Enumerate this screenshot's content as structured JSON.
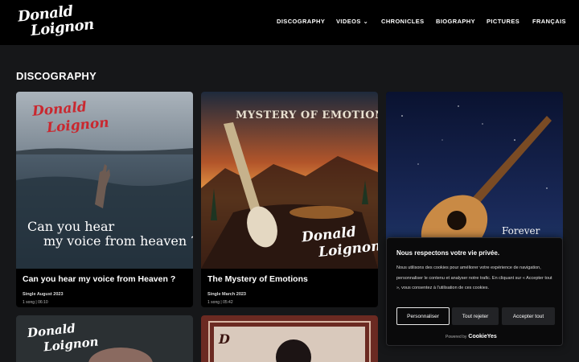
{
  "header": {
    "logo_line1": "Donald",
    "logo_line2": "Loignon",
    "nav": [
      {
        "label": "DISCOGRAPHY"
      },
      {
        "label": "VIDEOS",
        "chevron": "⌄"
      },
      {
        "label": "CHRONICLES"
      },
      {
        "label": "BIOGRAPHY"
      },
      {
        "label": "PICTURES"
      },
      {
        "label": "FRANÇAIS"
      }
    ]
  },
  "section_title": "DISCOGRAPHY",
  "cards": [
    {
      "art_logo1": "Donald",
      "art_logo2": "Loignon",
      "art_line1": "Can you hear",
      "art_line2": "my voice from heaven ?",
      "title": "Can you hear my voice from Heaven ?",
      "meta": "Single August 2023",
      "songs": "1 song",
      "duration": "06:10"
    },
    {
      "art_title": "MYSTERY OF EMOTIONS",
      "art_logo1": "Donald",
      "art_logo2": "Loignon",
      "title": "The Mystery of Emotions",
      "meta": "Single March 2023",
      "songs": "1 song",
      "duration": "05:42"
    },
    {
      "art_word": "Forever"
    },
    {
      "art_logo1": "Donald",
      "art_logo2": "Loignon"
    },
    {
      "art_letter": "D"
    }
  ],
  "cookie_banner": {
    "title": "Nous respectons votre vie privée.",
    "text": "Nous utilisons des cookies pour améliorer votre expérience de navigation, personnaliser le contenu et analyser notre trafic. En cliquant sur « Accepter tout », vous consentez à l'utilisation de ces cookies.",
    "customize_label": "Personnaliser",
    "reject_label": "Tout rejeter",
    "accept_label": "Accepter tout",
    "powered_by": "Powered by",
    "brand": "CookieYes"
  },
  "icons": [
    "chevron-down-icon",
    "moon-icon"
  ]
}
